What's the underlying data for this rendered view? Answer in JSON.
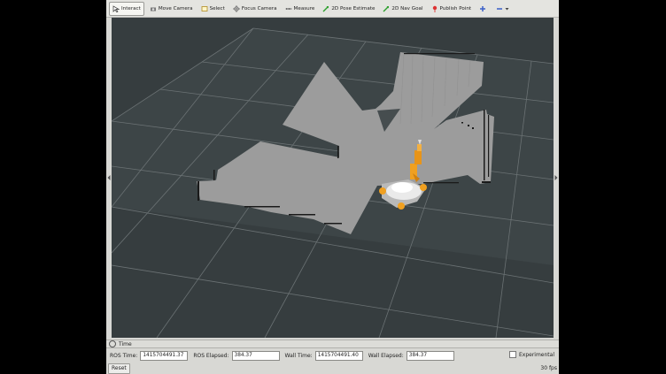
{
  "toolbar": {
    "items": [
      {
        "label": "Interact",
        "icon": "cursor-icon"
      },
      {
        "label": "Move Camera",
        "icon": "camera-icon"
      },
      {
        "label": "Select",
        "icon": "select-box-icon"
      },
      {
        "label": "Focus Camera",
        "icon": "crosshair-icon"
      },
      {
        "label": "Measure",
        "icon": "ruler-icon"
      },
      {
        "label": "2D Pose Estimate",
        "icon": "green-arrow-icon"
      },
      {
        "label": "2D Nav Goal",
        "icon": "green-arrow-icon"
      },
      {
        "label": "Publish Point",
        "icon": "pin-icon"
      }
    ],
    "active": "Interact"
  },
  "time_panel": {
    "title": "Time",
    "ros_time_label": "ROS Time:",
    "ros_time_value": "1415704491.37",
    "ros_elapsed_label": "ROS Elapsed:",
    "ros_elapsed_value": "384.37",
    "wall_time_label": "Wall Time:",
    "wall_time_value": "1415704491.40",
    "wall_elapsed_label": "Wall Elapsed:",
    "wall_elapsed_value": "384.37",
    "experimental_label": "Experimental"
  },
  "status": {
    "reset_label": "Reset",
    "fps": "30 fps"
  },
  "colors": {
    "viewport_bg": "#363d3f",
    "map_free": "#9a9a9a",
    "robot_orange": "#f0a020"
  }
}
